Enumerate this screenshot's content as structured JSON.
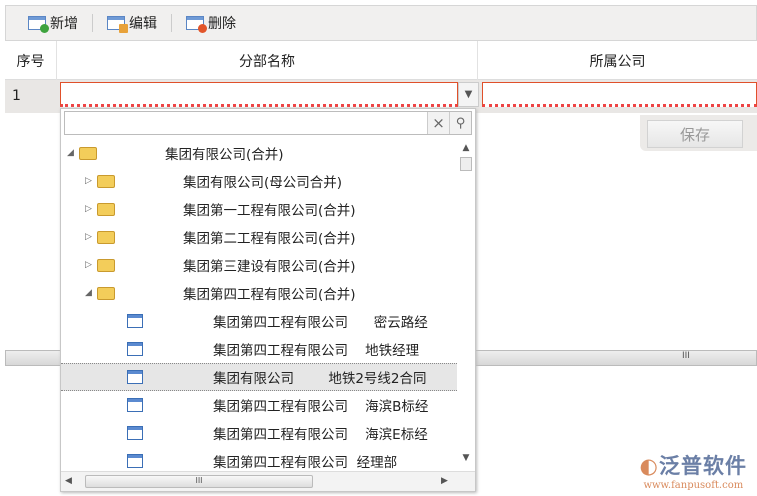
{
  "toolbar": {
    "add": "新增",
    "edit": "编辑",
    "delete": "删除"
  },
  "grid": {
    "headers": [
      "序号",
      "分部名称",
      "所属公司"
    ],
    "rows": [
      {
        "index": "1"
      }
    ]
  },
  "dropdown": {
    "search_placeholder": "",
    "clear": "×",
    "tree": [
      {
        "label": "集团有限公司(合并)",
        "level": 0,
        "type": "folder",
        "expanded": true
      },
      {
        "label": "集团有限公司(母公司合并)",
        "level": 1,
        "type": "folder"
      },
      {
        "label": "集团第一工程有限公司(合并)",
        "level": 1,
        "type": "folder"
      },
      {
        "label": "集团第二工程有限公司(合并)",
        "level": 1,
        "type": "folder"
      },
      {
        "label": "集团第三建设有限公司(合并)",
        "level": 1,
        "type": "folder"
      },
      {
        "label": "集团第四工程有限公司(合并)",
        "level": 1,
        "type": "folder",
        "expanded": true
      },
      {
        "label": "集团第四工程有限公司      密云路经",
        "level": 2,
        "type": "leaf"
      },
      {
        "label": "集团第四工程有限公司    地铁经理",
        "level": 2,
        "type": "leaf"
      },
      {
        "label": "集团有限公司        地铁2号线2合同",
        "level": 2,
        "type": "leaf",
        "selected": true
      },
      {
        "label": "集团第四工程有限公司    海滨B标经",
        "level": 2,
        "type": "leaf"
      },
      {
        "label": "集团第四工程有限公司    海滨E标经",
        "level": 2,
        "type": "leaf"
      },
      {
        "label": "集团第四工程有限公司  经理部",
        "level": 2,
        "type": "leaf"
      }
    ]
  },
  "save": "保存",
  "logo": {
    "name": "泛普软件",
    "url": "www.fanpusoft.com"
  },
  "scroll_thumb": "III"
}
